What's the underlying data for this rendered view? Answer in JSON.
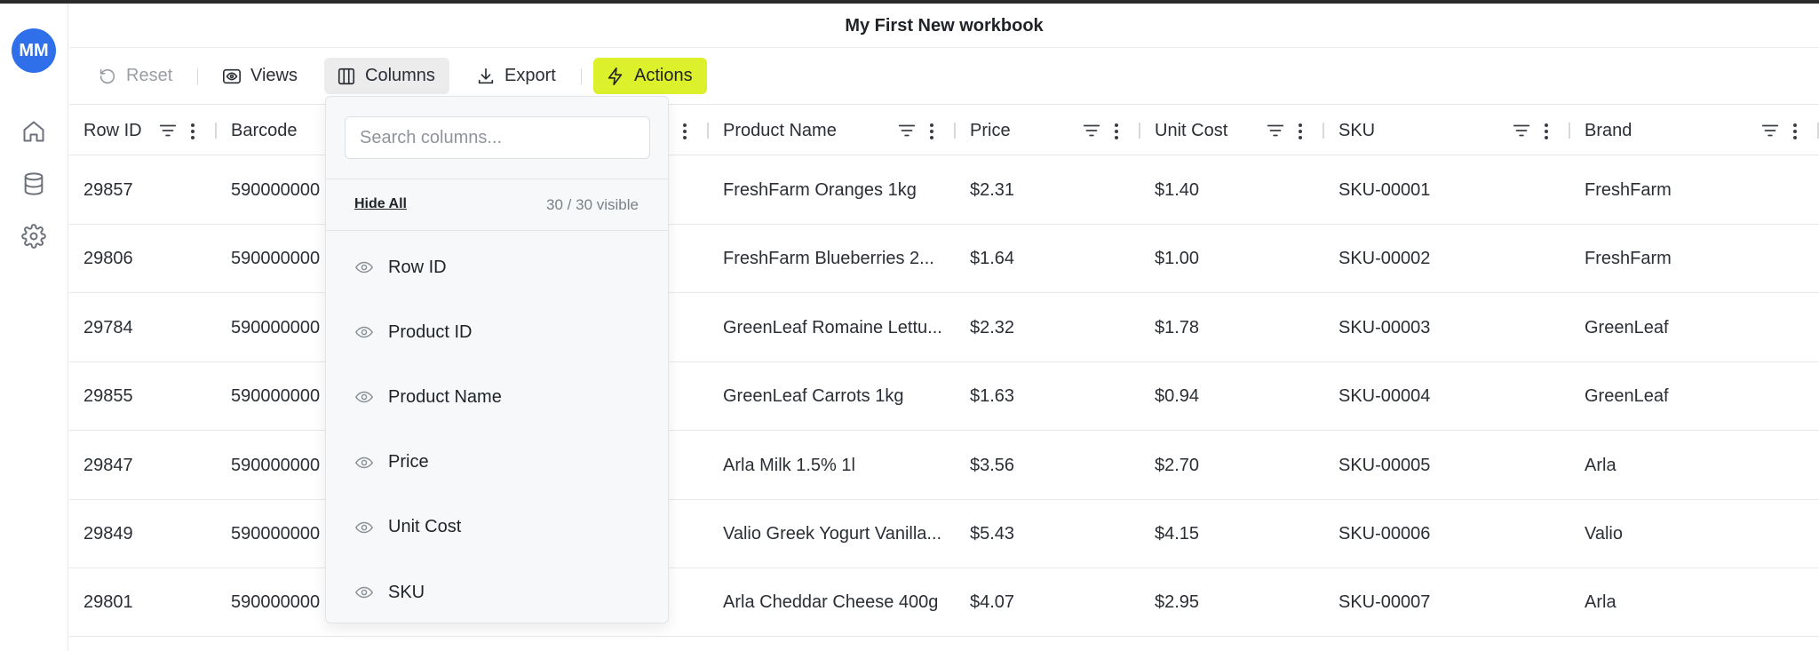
{
  "app": {
    "avatar_initials": "MM",
    "workbook_title": "My First New workbook",
    "accent_color": "#dcf02b",
    "avatar_color": "#2f6fea"
  },
  "rail": {
    "items": [
      {
        "icon": "home-icon"
      },
      {
        "icon": "database-icon"
      },
      {
        "icon": "gear-icon"
      }
    ]
  },
  "toolbar": {
    "reset_label": "Reset",
    "views_label": "Views",
    "columns_label": "Columns",
    "export_label": "Export",
    "actions_label": "Actions"
  },
  "table": {
    "headers": [
      "Row ID",
      "Barcode",
      "",
      "Product Name",
      "Price",
      "Unit Cost",
      "SKU",
      "Brand"
    ],
    "rows": [
      [
        "29857",
        "590000000",
        "",
        "FreshFarm Oranges 1kg",
        "$2.31",
        "$1.40",
        "SKU-00001",
        "FreshFarm"
      ],
      [
        "29806",
        "590000000",
        "",
        "FreshFarm Blueberries 2...",
        "$1.64",
        "$1.00",
        "SKU-00002",
        "FreshFarm"
      ],
      [
        "29784",
        "590000000",
        "",
        "GreenLeaf Romaine Lettu...",
        "$2.32",
        "$1.78",
        "SKU-00003",
        "GreenLeaf"
      ],
      [
        "29855",
        "590000000",
        "",
        "GreenLeaf Carrots 1kg",
        "$1.63",
        "$0.94",
        "SKU-00004",
        "GreenLeaf"
      ],
      [
        "29847",
        "590000000",
        "",
        "Arla Milk 1.5% 1l",
        "$3.56",
        "$2.70",
        "SKU-00005",
        "Arla"
      ],
      [
        "29849",
        "590000000",
        "",
        "Valio Greek Yogurt Vanilla...",
        "$5.43",
        "$4.15",
        "SKU-00006",
        "Valio"
      ],
      [
        "29801",
        "590000000",
        "",
        "Arla Cheddar Cheese 400g",
        "$4.07",
        "$2.95",
        "SKU-00007",
        "Arla"
      ]
    ]
  },
  "columns_menu": {
    "search_placeholder": "Search columns...",
    "hide_all_label": "Hide All",
    "visible_count": "30 / 30 visible",
    "items": [
      "Row ID",
      "Product ID",
      "Product Name",
      "Price",
      "Unit Cost",
      "SKU"
    ]
  }
}
